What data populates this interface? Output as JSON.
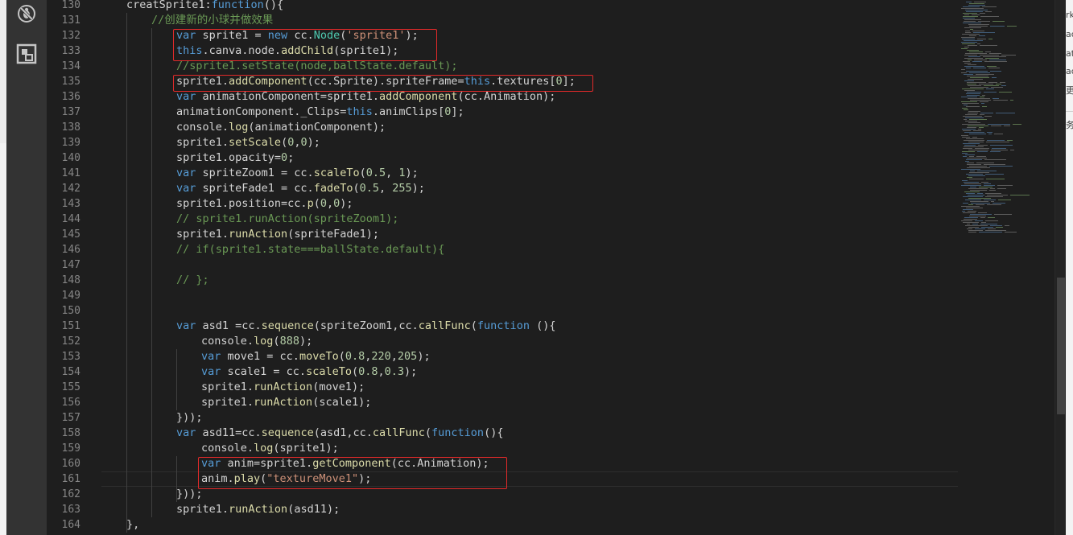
{
  "colors": {
    "editor_bg": "#1e1e1e",
    "activity_bar": "#333333",
    "highlight_box": "#e32a2a",
    "keyword": "#569cd6",
    "string": "#ce9178",
    "number": "#b5cea8",
    "comment": "#6a9955",
    "function": "#dcdcaa"
  },
  "activity_bar": {
    "icons": [
      "bug-slash-icon",
      "extensions-icon"
    ]
  },
  "editor": {
    "line_numbers": [
      "130",
      "131",
      "132",
      "133",
      "134",
      "135",
      "136",
      "137",
      "138",
      "139",
      "140",
      "141",
      "142",
      "143",
      "144",
      "145",
      "146",
      "147",
      "148",
      "149",
      "150",
      "151",
      "152",
      "153",
      "154",
      "155",
      "156",
      "157",
      "158",
      "159",
      "160",
      "161",
      "162",
      "163",
      "164"
    ],
    "lines": [
      {
        "no": "130",
        "indent": 1,
        "tokens": [
          [
            "creatSprite1:",
            ""
          ],
          [
            "function",
            "kw"
          ],
          [
            "(){",
            ""
          ]
        ]
      },
      {
        "no": "131",
        "indent": 2,
        "tokens": [
          [
            "//创建新的小球并做效果",
            "cmt"
          ]
        ]
      },
      {
        "no": "132",
        "indent": 3,
        "tokens": [
          [
            "var",
            "kw"
          ],
          [
            " sprite1 = ",
            ""
          ],
          [
            "new",
            "kw"
          ],
          [
            " cc.",
            ""
          ],
          [
            "Node",
            "type"
          ],
          [
            "(",
            ""
          ],
          [
            "'sprite1'",
            "str"
          ],
          [
            ");",
            ""
          ]
        ]
      },
      {
        "no": "133",
        "indent": 3,
        "tokens": [
          [
            "this",
            "kw"
          ],
          [
            ".canva.node.",
            ""
          ],
          [
            "addChild",
            "fn"
          ],
          [
            "(sprite1);",
            ""
          ]
        ]
      },
      {
        "no": "134",
        "indent": 3,
        "tokens": [
          [
            "//sprite1.setState(node,ballState.default);",
            "cmt"
          ]
        ]
      },
      {
        "no": "135",
        "indent": 3,
        "tokens": [
          [
            "sprite1.",
            ""
          ],
          [
            "addComponent",
            "fn"
          ],
          [
            "(cc.Sprite).spriteFrame=",
            ""
          ],
          [
            "this",
            "kw"
          ],
          [
            ".textures[",
            ""
          ],
          [
            "0",
            "num"
          ],
          [
            "];",
            ""
          ]
        ]
      },
      {
        "no": "136",
        "indent": 3,
        "tokens": [
          [
            "var",
            "kw"
          ],
          [
            " animationComponent=sprite1.",
            ""
          ],
          [
            "addComponent",
            "fn"
          ],
          [
            "(cc.Animation);",
            ""
          ]
        ]
      },
      {
        "no": "137",
        "indent": 3,
        "tokens": [
          [
            "animationComponent._Clips=",
            ""
          ],
          [
            "this",
            "kw"
          ],
          [
            ".animClips[",
            ""
          ],
          [
            "0",
            "num"
          ],
          [
            "];",
            ""
          ]
        ]
      },
      {
        "no": "138",
        "indent": 3,
        "tokens": [
          [
            "console.",
            ""
          ],
          [
            "log",
            "fn"
          ],
          [
            "(animationComponent);",
            ""
          ]
        ]
      },
      {
        "no": "139",
        "indent": 3,
        "tokens": [
          [
            "sprite1.",
            ""
          ],
          [
            "setScale",
            "fn"
          ],
          [
            "(",
            ""
          ],
          [
            "0",
            "num"
          ],
          [
            ",",
            ""
          ],
          [
            "0",
            "num"
          ],
          [
            ");",
            ""
          ]
        ]
      },
      {
        "no": "140",
        "indent": 3,
        "tokens": [
          [
            "sprite1.opacity=",
            ""
          ],
          [
            "0",
            "num"
          ],
          [
            ";",
            ""
          ]
        ]
      },
      {
        "no": "141",
        "indent": 3,
        "tokens": [
          [
            "var",
            "kw"
          ],
          [
            " spriteZoom1 = cc.",
            ""
          ],
          [
            "scaleTo",
            "fn"
          ],
          [
            "(",
            ""
          ],
          [
            "0.5",
            "num"
          ],
          [
            ", ",
            ""
          ],
          [
            "1",
            "num"
          ],
          [
            ");",
            ""
          ]
        ]
      },
      {
        "no": "142",
        "indent": 3,
        "tokens": [
          [
            "var",
            "kw"
          ],
          [
            " spriteFade1 = cc.",
            ""
          ],
          [
            "fadeTo",
            "fn"
          ],
          [
            "(",
            ""
          ],
          [
            "0.5",
            "num"
          ],
          [
            ", ",
            ""
          ],
          [
            "255",
            "num"
          ],
          [
            ");",
            ""
          ]
        ]
      },
      {
        "no": "143",
        "indent": 3,
        "tokens": [
          [
            "sprite1.position=cc.",
            ""
          ],
          [
            "p",
            "fn"
          ],
          [
            "(",
            ""
          ],
          [
            "0",
            "num"
          ],
          [
            ",",
            ""
          ],
          [
            "0",
            "num"
          ],
          [
            ");",
            ""
          ]
        ]
      },
      {
        "no": "144",
        "indent": 3,
        "tokens": [
          [
            "// sprite1.runAction(spriteZoom1);",
            "cmt"
          ]
        ]
      },
      {
        "no": "145",
        "indent": 3,
        "tokens": [
          [
            "sprite1.",
            ""
          ],
          [
            "runAction",
            "fn"
          ],
          [
            "(spriteFade1);",
            ""
          ]
        ]
      },
      {
        "no": "146",
        "indent": 3,
        "tokens": [
          [
            "// if(sprite1.state===ballState.default){",
            "cmt"
          ]
        ]
      },
      {
        "no": "147",
        "indent": 3,
        "tokens": []
      },
      {
        "no": "148",
        "indent": 3,
        "tokens": [
          [
            "// };",
            "cmt"
          ]
        ]
      },
      {
        "no": "149",
        "indent": 3,
        "tokens": []
      },
      {
        "no": "150",
        "indent": 3,
        "tokens": []
      },
      {
        "no": "151",
        "indent": 3,
        "tokens": [
          [
            "var",
            "kw"
          ],
          [
            " asd1 =cc.",
            ""
          ],
          [
            "sequence",
            "fn"
          ],
          [
            "(spriteZoom1,cc.",
            ""
          ],
          [
            "callFunc",
            "fn"
          ],
          [
            "(",
            ""
          ],
          [
            "function",
            "kw"
          ],
          [
            " (){",
            ""
          ]
        ]
      },
      {
        "no": "152",
        "indent": 4,
        "tokens": [
          [
            "console.",
            ""
          ],
          [
            "log",
            "fn"
          ],
          [
            "(",
            ""
          ],
          [
            "888",
            "num"
          ],
          [
            ");",
            ""
          ]
        ]
      },
      {
        "no": "153",
        "indent": 4,
        "tokens": [
          [
            "var",
            "kw"
          ],
          [
            " move1 = cc.",
            ""
          ],
          [
            "moveTo",
            "fn"
          ],
          [
            "(",
            ""
          ],
          [
            "0.8",
            "num"
          ],
          [
            ",",
            ""
          ],
          [
            "220",
            "num"
          ],
          [
            ",",
            ""
          ],
          [
            "205",
            "num"
          ],
          [
            ");",
            ""
          ]
        ]
      },
      {
        "no": "154",
        "indent": 4,
        "tokens": [
          [
            "var",
            "kw"
          ],
          [
            " scale1 = cc.",
            ""
          ],
          [
            "scaleTo",
            "fn"
          ],
          [
            "(",
            ""
          ],
          [
            "0.8",
            "num"
          ],
          [
            ",",
            ""
          ],
          [
            "0.3",
            "num"
          ],
          [
            ");",
            ""
          ]
        ]
      },
      {
        "no": "155",
        "indent": 4,
        "tokens": [
          [
            "sprite1.",
            ""
          ],
          [
            "runAction",
            "fn"
          ],
          [
            "(move1);",
            ""
          ]
        ]
      },
      {
        "no": "156",
        "indent": 4,
        "tokens": [
          [
            "sprite1.",
            ""
          ],
          [
            "runAction",
            "fn"
          ],
          [
            "(scale1);",
            ""
          ]
        ]
      },
      {
        "no": "157",
        "indent": 3,
        "tokens": [
          [
            "}));",
            ""
          ]
        ]
      },
      {
        "no": "158",
        "indent": 3,
        "tokens": [
          [
            "var",
            "kw"
          ],
          [
            " asd11=cc.",
            ""
          ],
          [
            "sequence",
            "fn"
          ],
          [
            "(asd1,cc.",
            ""
          ],
          [
            "callFunc",
            "fn"
          ],
          [
            "(",
            ""
          ],
          [
            "function",
            "kw"
          ],
          [
            "(){",
            ""
          ]
        ]
      },
      {
        "no": "159",
        "indent": 4,
        "tokens": [
          [
            "console.",
            ""
          ],
          [
            "log",
            "fn"
          ],
          [
            "(sprite1);",
            ""
          ]
        ]
      },
      {
        "no": "160",
        "indent": 4,
        "tokens": [
          [
            "var",
            "kw"
          ],
          [
            " anim=sprite1.",
            ""
          ],
          [
            "getComponent",
            "fn"
          ],
          [
            "(cc.Animation);",
            ""
          ]
        ]
      },
      {
        "no": "161",
        "indent": 4,
        "tokens": [
          [
            "anim.",
            ""
          ],
          [
            "play",
            "fn"
          ],
          [
            "(",
            ""
          ],
          [
            "\"textureMove1\"",
            "str"
          ],
          [
            ");",
            ""
          ]
        ]
      },
      {
        "no": "162",
        "indent": 3,
        "tokens": [
          [
            "}));",
            ""
          ]
        ]
      },
      {
        "no": "163",
        "indent": 3,
        "tokens": [
          [
            "sprite1.",
            ""
          ],
          [
            "runAction",
            "fn"
          ],
          [
            "(asd11);",
            ""
          ]
        ]
      },
      {
        "no": "164",
        "indent": 1,
        "tokens": [
          [
            "},",
            ""
          ]
        ]
      }
    ],
    "current_line": "161",
    "highlight_boxes": [
      {
        "lines": [
          "132",
          "133"
        ]
      },
      {
        "lines": [
          "135"
        ]
      },
      {
        "lines": [
          "160",
          "161"
        ]
      }
    ]
  },
  "right_panel_fragments": [
    "rk",
    "ac",
    "at",
    "ac",
    "更",
    "务"
  ]
}
